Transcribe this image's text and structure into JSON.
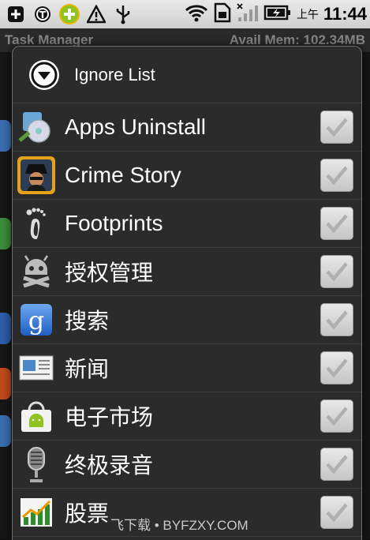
{
  "status_bar": {
    "ampm": "上午",
    "time": "11:44",
    "icons": [
      "add-icon",
      "settings-icon",
      "plus-circle-icon",
      "warning-icon",
      "usb-icon",
      "wifi-icon",
      "sim-icon",
      "signal-icon",
      "battery-charging-icon"
    ]
  },
  "background_app": {
    "title": "Task Manager",
    "avail_mem": "Avail Mem: 102.34MB"
  },
  "dialog": {
    "title": "Ignore List",
    "items": [
      {
        "label": "Apps Uninstall",
        "checked": true,
        "icon": "apps-uninstall-icon"
      },
      {
        "label": "Crime Story",
        "checked": true,
        "icon": "crime-story-icon"
      },
      {
        "label": "Footprints",
        "checked": true,
        "icon": "footprints-icon"
      },
      {
        "label": "授权管理",
        "checked": true,
        "icon": "superuser-icon"
      },
      {
        "label": "搜索",
        "checked": true,
        "icon": "google-search-icon"
      },
      {
        "label": "新闻",
        "checked": true,
        "icon": "news-icon"
      },
      {
        "label": "电子市场",
        "checked": true,
        "icon": "market-icon"
      },
      {
        "label": "终极录音",
        "checked": true,
        "icon": "microphone-icon"
      },
      {
        "label": "股票",
        "checked": true,
        "icon": "stocks-icon"
      }
    ]
  },
  "watermark": "飞下载 • BYFZXY.COM",
  "colors": {
    "dialog_bg": "#2b2b2b",
    "checkbox": "#d6d6d6",
    "check_mark": "#b0b0b0"
  }
}
